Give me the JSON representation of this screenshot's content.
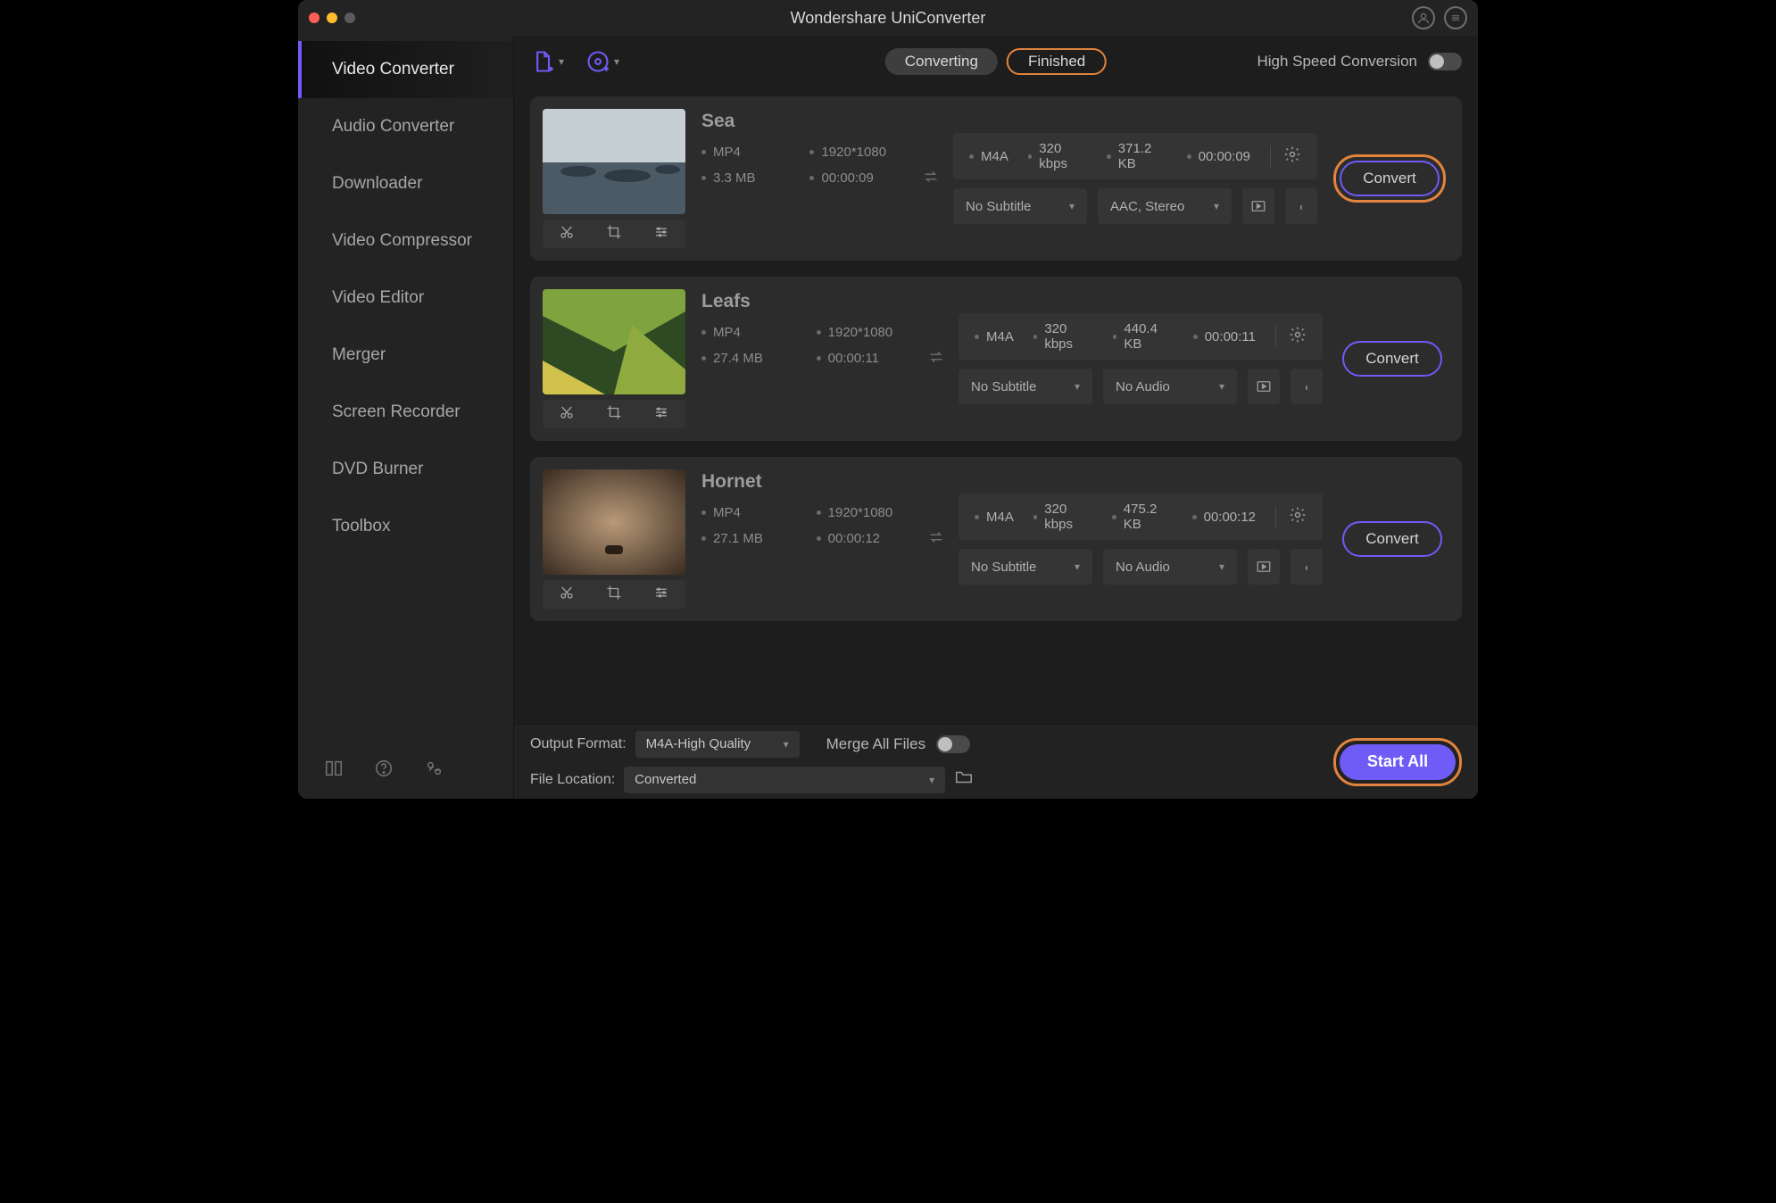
{
  "app_title": "Wondershare UniConverter",
  "sidebar": {
    "items": [
      {
        "label": "Video Converter",
        "active": true
      },
      {
        "label": "Audio Converter"
      },
      {
        "label": "Downloader"
      },
      {
        "label": "Video Compressor"
      },
      {
        "label": "Video Editor"
      },
      {
        "label": "Merger"
      },
      {
        "label": "Screen Recorder"
      },
      {
        "label": "DVD Burner"
      },
      {
        "label": "Toolbox"
      }
    ]
  },
  "tabs": {
    "converting": "Converting",
    "finished": "Finished",
    "active": "converting"
  },
  "high_speed_label": "High Speed Conversion",
  "files": [
    {
      "title": "Sea",
      "src": {
        "format": "MP4",
        "res": "1920*1080",
        "size": "3.3 MB",
        "dur": "00:00:09"
      },
      "out": {
        "format": "M4A",
        "bitrate": "320 kbps",
        "size": "371.2 KB",
        "dur": "00:00:09"
      },
      "subtitle": "No Subtitle",
      "audio": "AAC, Stereo",
      "convert_label": "Convert",
      "highlight": true
    },
    {
      "title": "Leafs",
      "src": {
        "format": "MP4",
        "res": "1920*1080",
        "size": "27.4 MB",
        "dur": "00:00:11"
      },
      "out": {
        "format": "M4A",
        "bitrate": "320 kbps",
        "size": "440.4 KB",
        "dur": "00:00:11"
      },
      "subtitle": "No Subtitle",
      "audio": "No Audio",
      "convert_label": "Convert",
      "highlight": false
    },
    {
      "title": "Hornet",
      "src": {
        "format": "MP4",
        "res": "1920*1080",
        "size": "27.1 MB",
        "dur": "00:00:12"
      },
      "out": {
        "format": "M4A",
        "bitrate": "320 kbps",
        "size": "475.2 KB",
        "dur": "00:00:12"
      },
      "subtitle": "No Subtitle",
      "audio": "No Audio",
      "convert_label": "Convert",
      "highlight": false
    }
  ],
  "bottom": {
    "output_format_label": "Output Format:",
    "output_format_value": "M4A-High Quality",
    "file_location_label": "File Location:",
    "file_location_value": "Converted",
    "merge_label": "Merge All Files",
    "start_all": "Start All"
  }
}
